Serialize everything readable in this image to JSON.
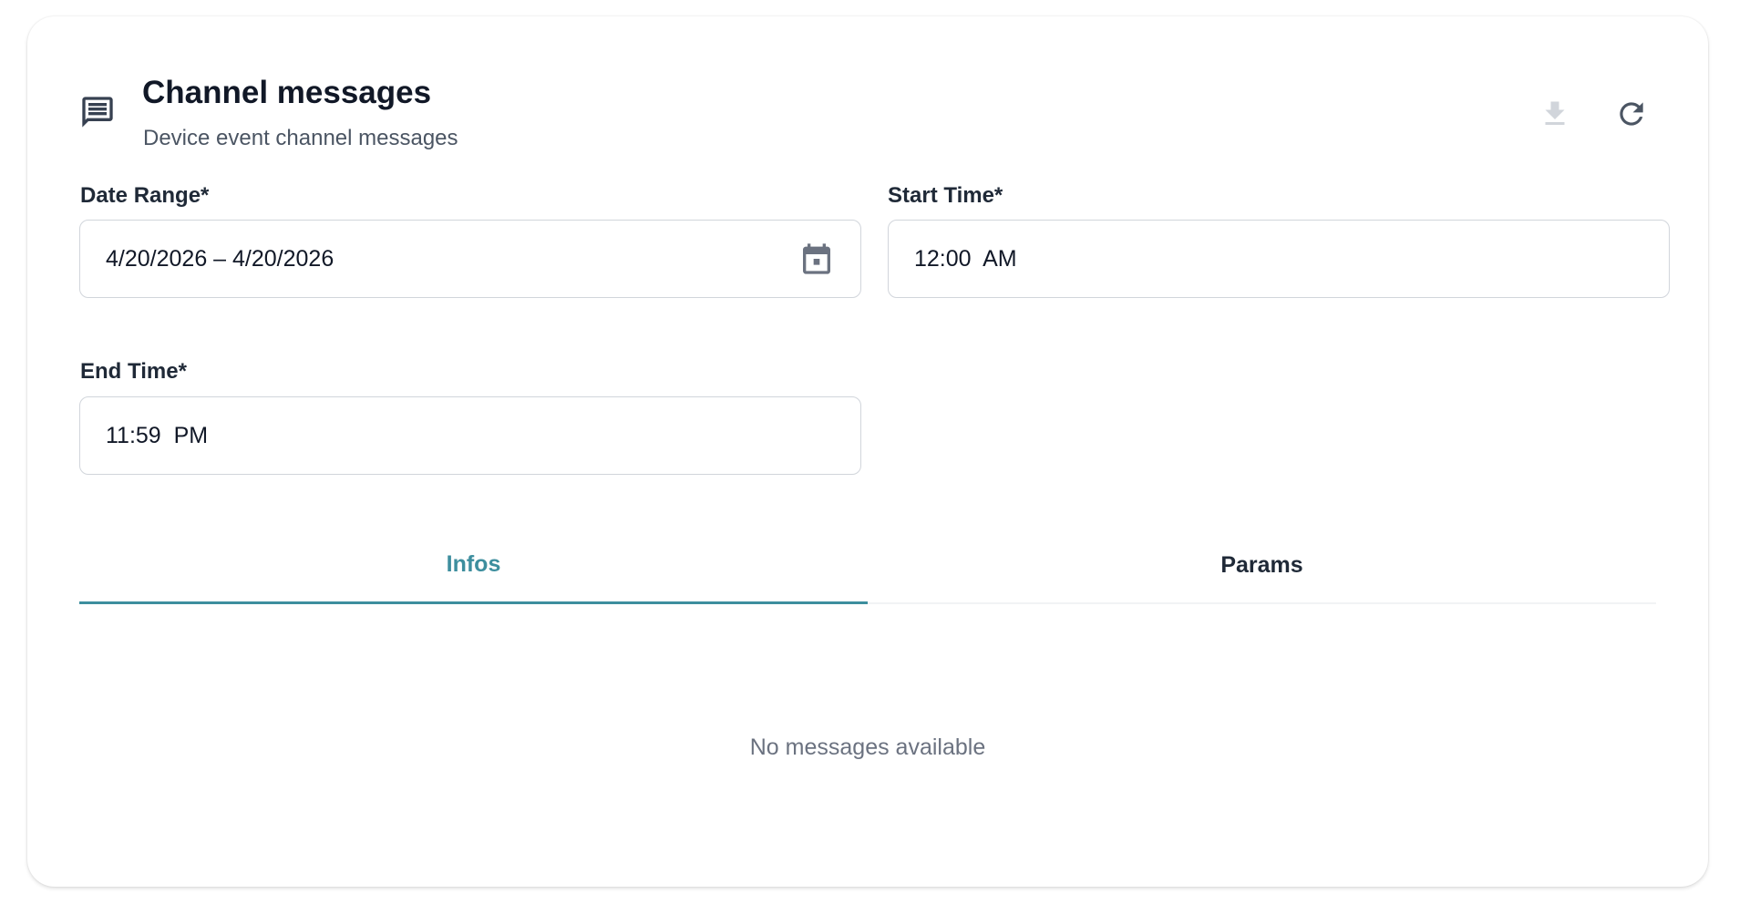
{
  "header": {
    "title": "Channel messages",
    "subtitle": "Device event channel messages",
    "icon": "message-icon"
  },
  "actions": {
    "download_icon": "download-icon",
    "refresh_icon": "refresh-icon"
  },
  "filters": {
    "date_range": {
      "label": "Date Range*",
      "value": "4/20/2026 – 4/20/2026",
      "icon": "calendar-icon"
    },
    "start_time": {
      "label": "Start Time*",
      "value": "12:00  AM"
    },
    "end_time": {
      "label": "End Time*",
      "value": "11:59  PM"
    }
  },
  "tabs": [
    {
      "label": "Infos",
      "active": true
    },
    {
      "label": "Params",
      "active": false
    }
  ],
  "content": {
    "empty_message": "No messages available"
  },
  "colors": {
    "accent": "#3d8e9e",
    "title": "#111827",
    "muted": "#6b7280"
  }
}
